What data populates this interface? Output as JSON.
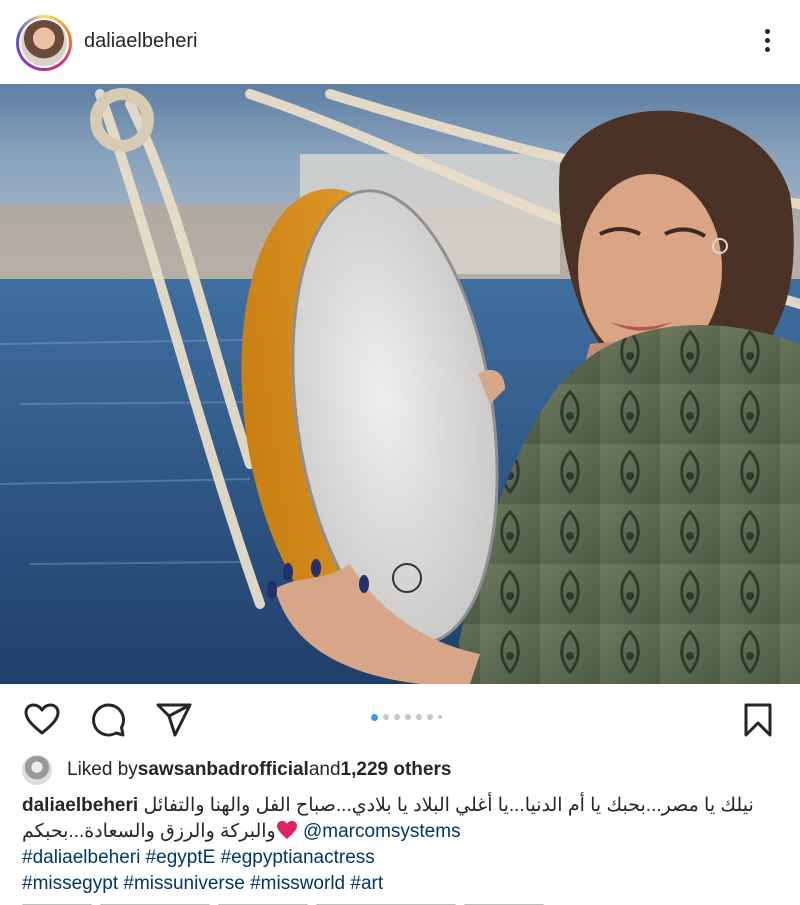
{
  "post": {
    "username": "daliaelbeheri",
    "more_icon": "more-vertical-icon"
  },
  "carousel": {
    "slide_count": 7,
    "active_index": 0
  },
  "likes": {
    "prefix": "Liked by ",
    "liker": "sawsanbadrofficial",
    "and": " and ",
    "count": "1,229 others"
  },
  "caption": {
    "username": "daliaelbeheri",
    "line1": "نيلك يا مصر...بحبك يا أم الدنيا...يا أغلي البلاد يا بلادي...صباح الفل والهنا والتفائل",
    "line2_text": "والبركة والرزق والسعادة...بحبكم",
    "line2_mention": "@marcomsystems",
    "hashtags_line1": "#daliaelbeheri #egyptE #egpyptianactress",
    "hashtags_line2": "#missegypt #missuniverse #missworld #art"
  },
  "colors": {
    "link": "#00376b",
    "active_dot": "#3897f0",
    "heart": "#e0245e"
  }
}
